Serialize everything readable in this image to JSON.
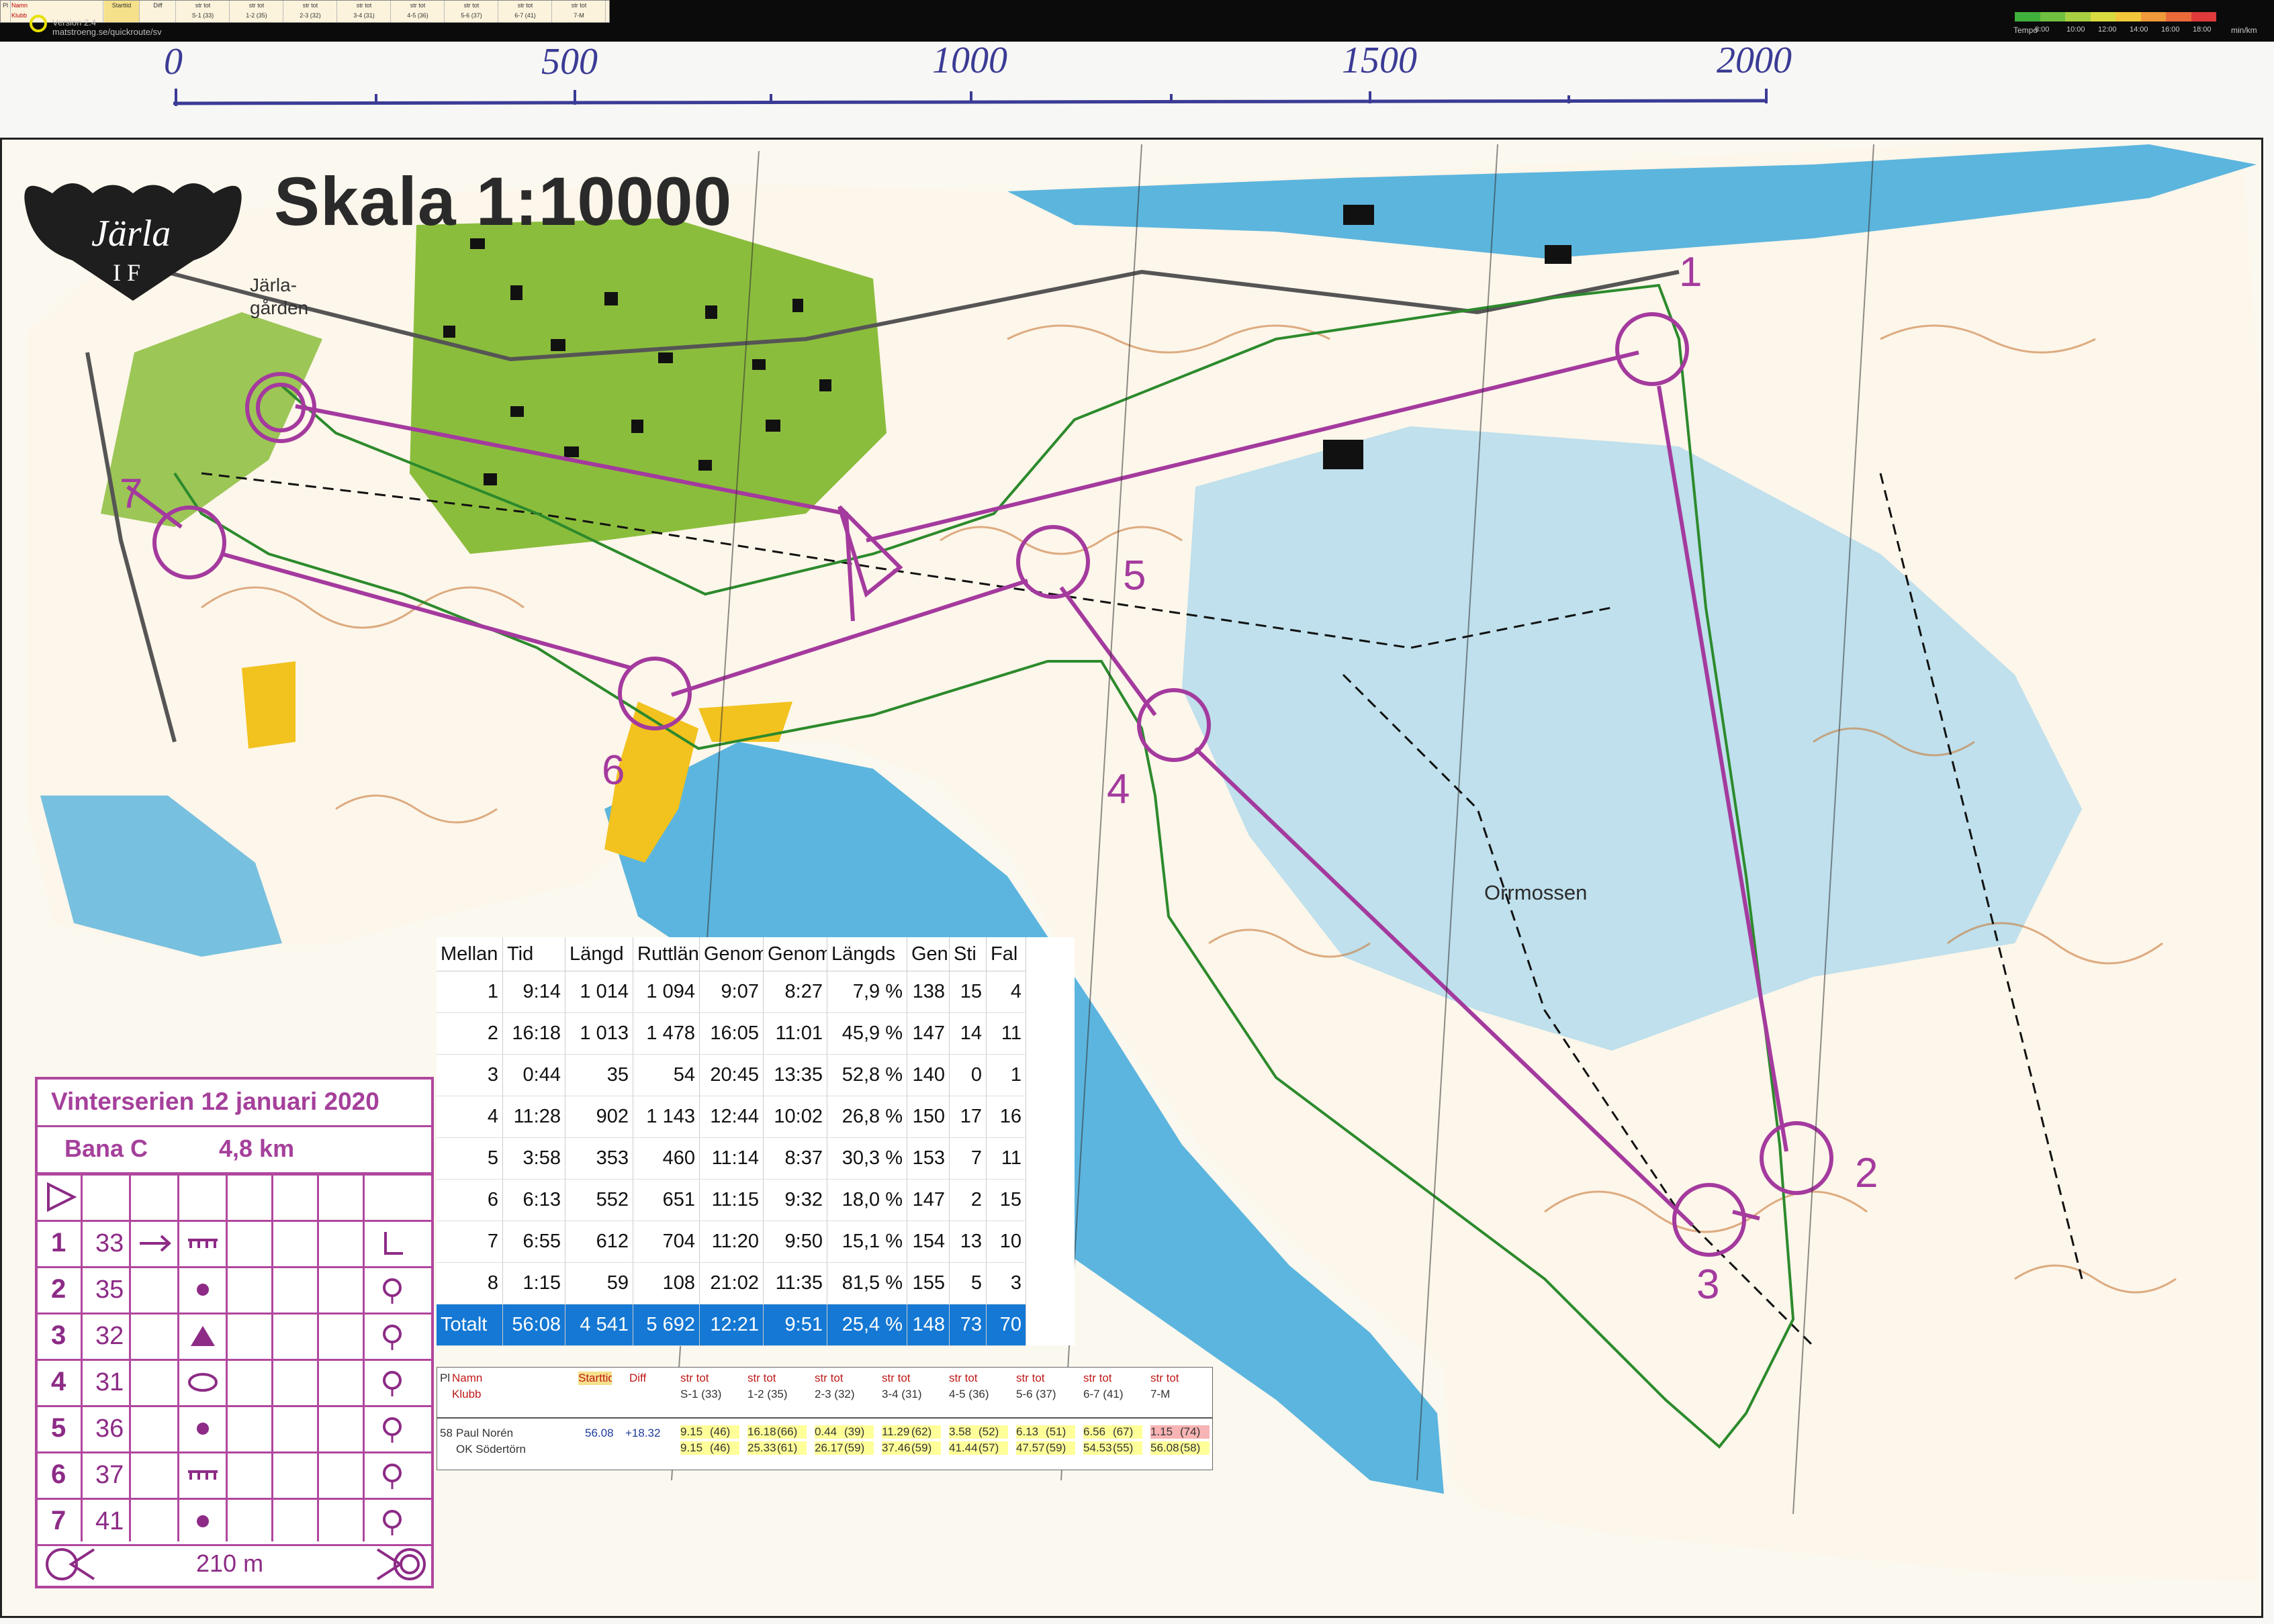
{
  "app": {
    "version": "Version 2.4",
    "url": "matstroeng.se/quickroute/sv",
    "mini_table": {
      "col_pl": "Pl",
      "col_namn": "Namn",
      "col_klubb": "Klubb",
      "col_starttid": "Starttid",
      "col_diff": "Diff",
      "legs": [
        {
          "top": "str tot",
          "bottom": "S-1 (33)"
        },
        {
          "top": "str tot",
          "bottom": "1-2 (35)"
        },
        {
          "top": "str tot",
          "bottom": "2-3 (32)"
        },
        {
          "top": "str tot",
          "bottom": "3-4 (31)"
        },
        {
          "top": "str tot",
          "bottom": "4-5 (36)"
        },
        {
          "top": "str tot",
          "bottom": "5-6 (37)"
        },
        {
          "top": "str tot",
          "bottom": "6-7 (41)"
        },
        {
          "top": "str tot",
          "bottom": "7-M"
        }
      ]
    },
    "tempo": {
      "label": "Tempo",
      "unit": "min/km",
      "ticks": [
        "8:00",
        "10:00",
        "12:00",
        "14:00",
        "16:00",
        "18:00"
      ],
      "colors": [
        "#3fb03a",
        "#6fc040",
        "#a8cf42",
        "#d9dc40",
        "#f0c83a",
        "#f09a3a",
        "#ea6a3a",
        "#e03a3a"
      ]
    }
  },
  "map": {
    "ruler_labels": [
      "0",
      "500",
      "1000",
      "1500",
      "2000"
    ],
    "scale_title": "Skala 1:10000",
    "club_logo_text": "Järla",
    "club_logo_sub": "I F",
    "place_label_1": "Järla-",
    "place_label_2": "gården",
    "area_label": "Orrmossen",
    "control_numbers": [
      "1",
      "2",
      "3",
      "4",
      "5",
      "6",
      "7"
    ]
  },
  "split_table": {
    "headers": [
      "Mellan",
      "Tid",
      "Längd",
      "Ruttlängd",
      "Genom",
      "Genom",
      "Längds",
      "Gen",
      "Sti",
      "Fal"
    ],
    "rows": [
      [
        "1",
        "9:14",
        "1 014",
        "1 094",
        "9:07",
        "8:27",
        "7,9 %",
        "138",
        "15",
        "4"
      ],
      [
        "2",
        "16:18",
        "1 013",
        "1 478",
        "16:05",
        "11:01",
        "45,9 %",
        "147",
        "14",
        "11"
      ],
      [
        "3",
        "0:44",
        "35",
        "54",
        "20:45",
        "13:35",
        "52,8 %",
        "140",
        "0",
        "1"
      ],
      [
        "4",
        "11:28",
        "902",
        "1 143",
        "12:44",
        "10:02",
        "26,8 %",
        "150",
        "17",
        "16"
      ],
      [
        "5",
        "3:58",
        "353",
        "460",
        "11:14",
        "8:37",
        "30,3 %",
        "153",
        "7",
        "11"
      ],
      [
        "6",
        "6:13",
        "552",
        "651",
        "11:15",
        "9:32",
        "18,0 %",
        "147",
        "2",
        "15"
      ],
      [
        "7",
        "6:55",
        "612",
        "704",
        "11:20",
        "9:50",
        "15,1 %",
        "154",
        "13",
        "10"
      ],
      [
        "8",
        "1:15",
        "59",
        "108",
        "21:02",
        "11:35",
        "81,5 %",
        "155",
        "5",
        "3"
      ]
    ],
    "total": [
      "Totalt",
      "56:08",
      "4 541",
      "5 692",
      "12:21",
      "9:51",
      "25,4 %",
      "148",
      "73",
      "70"
    ]
  },
  "description_sheet": {
    "title": "Vinterserien 12 januari 2020",
    "course": "Bana C",
    "length": "4,8 km",
    "controls": [
      {
        "num": "1",
        "code": "33"
      },
      {
        "num": "2",
        "code": "35"
      },
      {
        "num": "3",
        "code": "32"
      },
      {
        "num": "4",
        "code": "31"
      },
      {
        "num": "5",
        "code": "36"
      },
      {
        "num": "6",
        "code": "37"
      },
      {
        "num": "7",
        "code": "41"
      }
    ],
    "finish_distance": "210 m"
  },
  "results": {
    "head_pl": "Pl",
    "head_namn": "Namn",
    "head_klubb": "Klubb",
    "head_starttid": "Starttid",
    "head_diff": "Diff",
    "legs": [
      {
        "top": "str tot",
        "bottom": "S-1 (33)"
      },
      {
        "top": "str tot",
        "bottom": "1-2 (35)"
      },
      {
        "top": "str tot",
        "bottom": "2-3 (32)"
      },
      {
        "top": "str tot",
        "bottom": "3-4 (31)"
      },
      {
        "top": "str tot",
        "bottom": "4-5 (36)"
      },
      {
        "top": "str tot",
        "bottom": "5-6 (37)"
      },
      {
        "top": "str tot",
        "bottom": "6-7 (41)"
      },
      {
        "top": "str tot",
        "bottom": "7-M"
      }
    ],
    "runner": {
      "place": "58",
      "name": "Paul Norén",
      "club": "OK Södertörn",
      "starttid": "56.08",
      "diff": "+18.32",
      "legs": [
        {
          "split": "9.15",
          "split_rank": "(46)",
          "total": "9.15",
          "total_rank": "(46)"
        },
        {
          "split": "16.18",
          "split_rank": "(66)",
          "total": "25.33",
          "total_rank": "(61)"
        },
        {
          "split": "0.44",
          "split_rank": "(39)",
          "total": "26.17",
          "total_rank": "(59)"
        },
        {
          "split": "11.29",
          "split_rank": "(62)",
          "total": "37.46",
          "total_rank": "(59)"
        },
        {
          "split": "3.58",
          "split_rank": "(52)",
          "total": "41.44",
          "total_rank": "(57)"
        },
        {
          "split": "6.13",
          "split_rank": "(51)",
          "total": "47.57",
          "total_rank": "(59)"
        },
        {
          "split": "6.56",
          "split_rank": "(67)",
          "total": "54.53",
          "total_rank": "(55)"
        },
        {
          "split": "1.15",
          "split_rank": "(74)",
          "total": "56.08",
          "total_rank": "(58)"
        }
      ]
    }
  }
}
